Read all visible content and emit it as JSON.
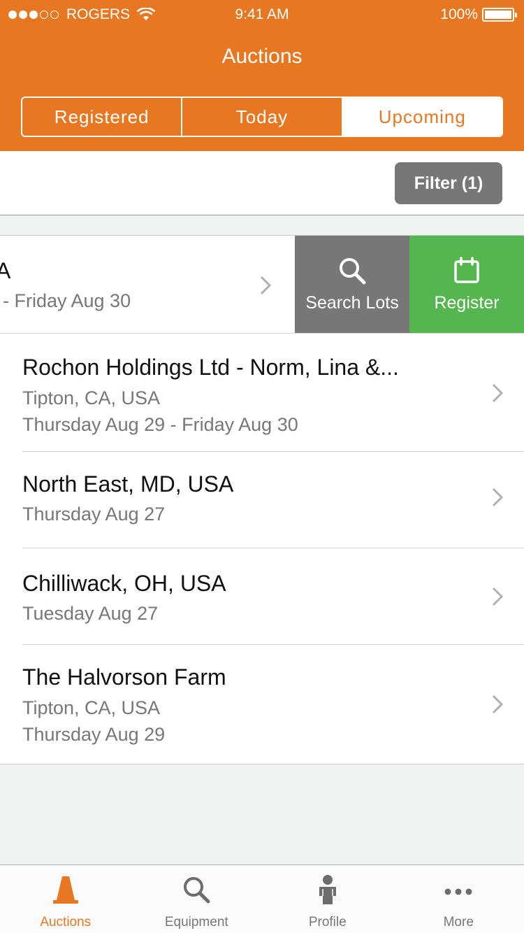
{
  "status_bar": {
    "carrier": "ROGERS",
    "time": "9:41 AM",
    "battery": "100%"
  },
  "header": {
    "title": "Auctions"
  },
  "segments": [
    {
      "label": "Registered",
      "active": false
    },
    {
      "label": "Today",
      "active": false
    },
    {
      "label": "Upcoming",
      "active": true
    }
  ],
  "filter": {
    "label": "Filter (1)"
  },
  "swiped_row": {
    "title": "A",
    "dates": "- Friday Aug 30",
    "actions": {
      "search_label": "Search Lots",
      "register_label": "Register"
    }
  },
  "auctions": [
    {
      "title": "Rochon Holdings Ltd - Norm, Lina &...",
      "location": "Tipton, CA, USA",
      "dates": "Thursday Aug 29 - Friday Aug 30"
    },
    {
      "title": "North East, MD, USA",
      "dates": "Thursday Aug 27"
    },
    {
      "title": "Chilliwack, OH, USA",
      "dates": "Tuesday Aug 27"
    },
    {
      "title": "The Halvorson Farm",
      "location": "Tipton, CA, USA",
      "dates": "Thursday Aug 29"
    }
  ],
  "tabbar": {
    "items": [
      {
        "label": "Auctions",
        "icon": "cone-icon",
        "active": true
      },
      {
        "label": "Equipment",
        "icon": "search-icon",
        "active": false
      },
      {
        "label": "Profile",
        "icon": "person-icon",
        "active": false
      },
      {
        "label": "More",
        "icon": "more-icon",
        "active": false
      }
    ]
  },
  "colors": {
    "brand_orange": "#e87722",
    "action_gray": "#777777",
    "register_green": "#55b54f"
  }
}
